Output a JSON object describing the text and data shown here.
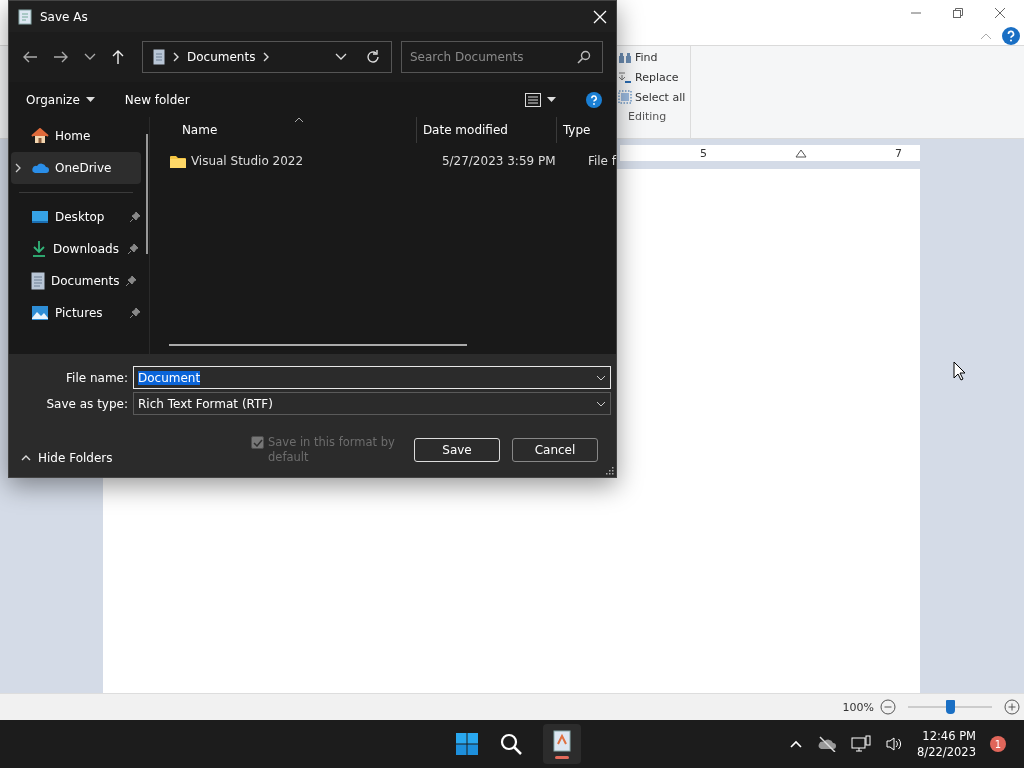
{
  "wordpad": {
    "ribbon_commands": [
      {
        "label": "Find",
        "kind": "find"
      },
      {
        "label": "Replace",
        "kind": "replace"
      },
      {
        "label": "Select all",
        "kind": "select"
      }
    ],
    "group_label": "Editing",
    "ruler_numbers": [
      "5",
      "7"
    ],
    "zoom": {
      "reading": "100%",
      "level": 0.5
    }
  },
  "dialog": {
    "title": "Save As",
    "address": "Documents",
    "search": {
      "placeholder": "Search Documents"
    },
    "toolbar": [
      "Organize",
      "New folder"
    ],
    "nav": [
      {
        "label": "Home",
        "kind": "home",
        "selected": false,
        "expandable": false,
        "pinned": false
      },
      {
        "label": "OneDrive",
        "kind": "cloud",
        "selected": true,
        "expandable": true,
        "pinned": false
      },
      {
        "label": "Desktop",
        "kind": "desktop",
        "selected": false,
        "expandable": false,
        "pinned": true
      },
      {
        "label": "Downloads",
        "kind": "download",
        "selected": false,
        "expandable": false,
        "pinned": true
      },
      {
        "label": "Documents",
        "kind": "document",
        "selected": false,
        "expandable": false,
        "pinned": true
      },
      {
        "label": "Pictures",
        "kind": "picture",
        "selected": false,
        "expandable": false,
        "pinned": true
      }
    ],
    "columns": [
      "Name",
      "Date modified",
      "Type"
    ],
    "rows": [
      {
        "name": "Visual Studio 2022",
        "date": "5/27/2023 3:59 PM",
        "type": "File f"
      }
    ],
    "file_name_label": "File name:",
    "file_name": "Document",
    "type_label": "Save as type:",
    "save_as_type": "Rich Text Format (RTF)",
    "save_default": {
      "label": "Save in this format by default",
      "checked": true,
      "disabled": true
    },
    "hide_folders": "Hide Folders",
    "buttons": [
      "Save",
      "Cancel"
    ]
  },
  "taskbar": {
    "time": "12:46 PM",
    "date": "8/22/2023",
    "notifications": "1"
  }
}
